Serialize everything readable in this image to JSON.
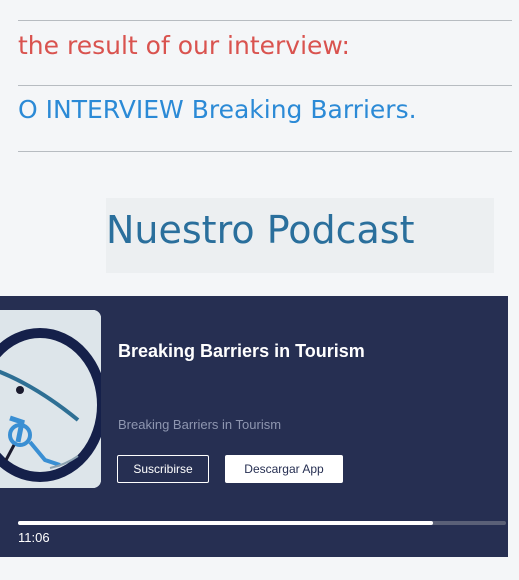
{
  "article": {
    "line_red": "the result of our interview:",
    "line_blue": "O INTERVIEW Breaking Barriers."
  },
  "section": {
    "podcast_title": "Nuestro Podcast"
  },
  "player": {
    "episode_title": "Breaking Barriers in Tourism",
    "show_title": "Breaking Barriers in Tourism",
    "subscribe_label": "Suscribirse",
    "download_label": "Descargar App",
    "time": "11:06",
    "progress": 0.85,
    "colors": {
      "background": "#262f52",
      "text": "#ffffff",
      "muted": "#8e96b0"
    }
  }
}
